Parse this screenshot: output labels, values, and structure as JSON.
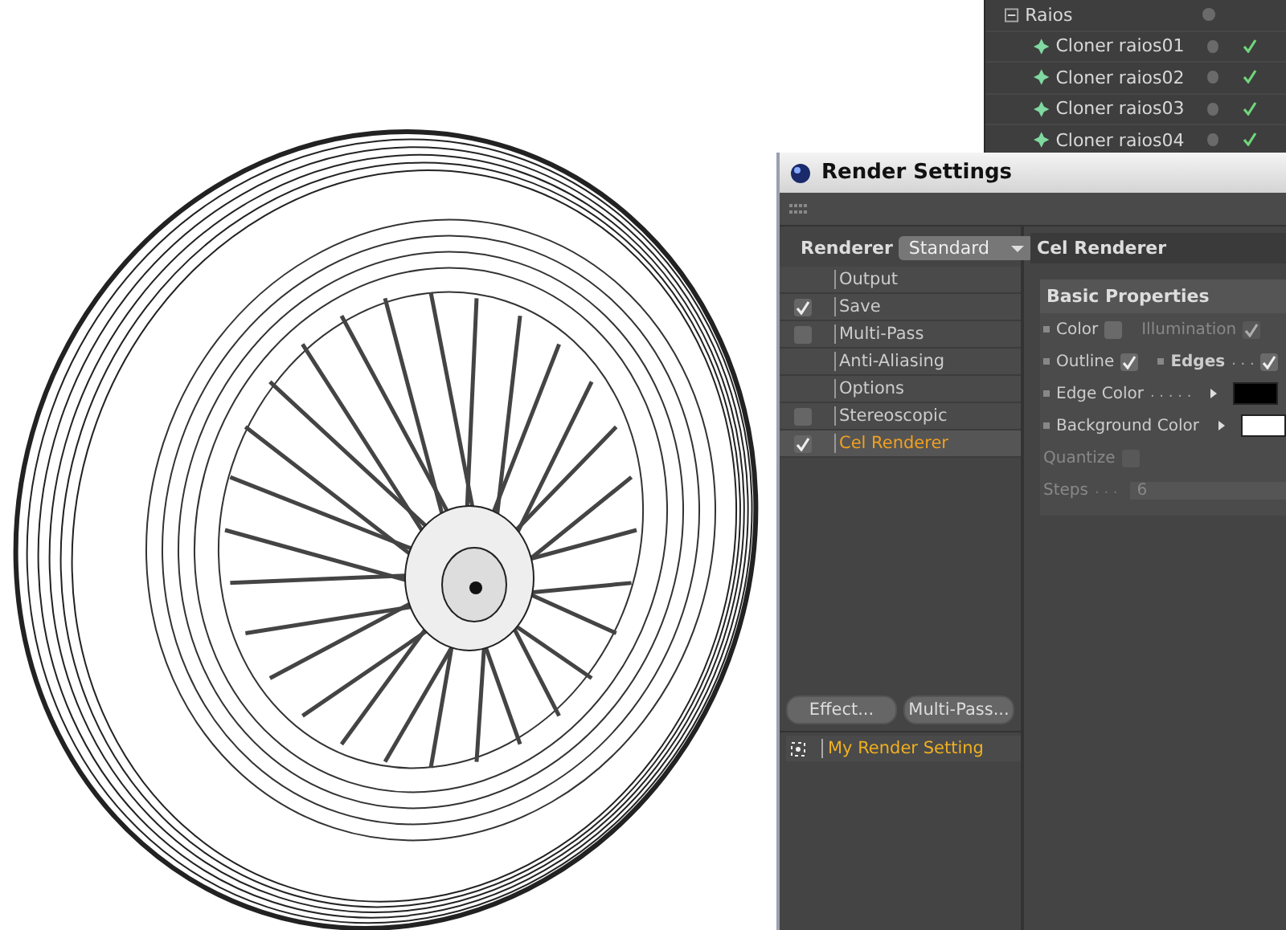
{
  "object_manager": {
    "rows": [
      {
        "label": "Raios",
        "expanded": true,
        "children": [
          {
            "label": "Cloner raios01",
            "enabled": true
          },
          {
            "label": "Cloner raios02",
            "enabled": true
          },
          {
            "label": "Cloner raios03",
            "enabled": true
          },
          {
            "label": "Cloner raios04",
            "enabled": true
          }
        ]
      }
    ]
  },
  "render_settings": {
    "title": "Render Settings",
    "renderer": {
      "label": "Renderer",
      "value": "Standard"
    },
    "items": [
      {
        "label": "Output",
        "kind": "plain",
        "selected": false
      },
      {
        "label": "Save",
        "kind": "check",
        "checked": true,
        "selected": false
      },
      {
        "label": "Multi-Pass",
        "kind": "check",
        "checked": false,
        "selected": false
      },
      {
        "label": "Anti-Aliasing",
        "kind": "plain",
        "selected": false
      },
      {
        "label": "Options",
        "kind": "plain",
        "selected": false
      },
      {
        "label": "Stereoscopic",
        "kind": "check",
        "checked": false,
        "selected": false
      },
      {
        "label": "Cel Renderer",
        "kind": "check",
        "checked": true,
        "selected": true
      }
    ],
    "buttons": [
      "Effect...",
      "Multi-Pass..."
    ],
    "settings": [
      {
        "label": "My Render Setting",
        "selected": true
      }
    ],
    "panel": {
      "title": "Cel Renderer",
      "section": "Basic Properties",
      "rows": [
        [
          {
            "kind": "check",
            "label": "Color",
            "checked": false,
            "disabled": false
          },
          {
            "kind": "check",
            "label": "Illumination",
            "checked": true,
            "disabled": true
          }
        ],
        [
          {
            "kind": "check",
            "label": "Outline",
            "checked": true,
            "disabled": false
          },
          {
            "kind": "check",
            "label": "Edges",
            "dots": ". . .",
            "bold": true,
            "checked": true,
            "disabled": false
          }
        ],
        [
          {
            "kind": "color",
            "label": "Edge Color",
            "dots": ". . . . .",
            "color": "#000000",
            "disabled": false
          }
        ],
        [
          {
            "kind": "color",
            "label": "Background Color",
            "color": "#ffffff",
            "disabled": false
          }
        ],
        [
          {
            "kind": "check",
            "label": "Quantize",
            "checked": false,
            "disabled": true
          }
        ],
        [
          {
            "kind": "number",
            "label": "Steps",
            "dots": ". . .",
            "value": "6",
            "disabled": true
          }
        ]
      ]
    }
  }
}
